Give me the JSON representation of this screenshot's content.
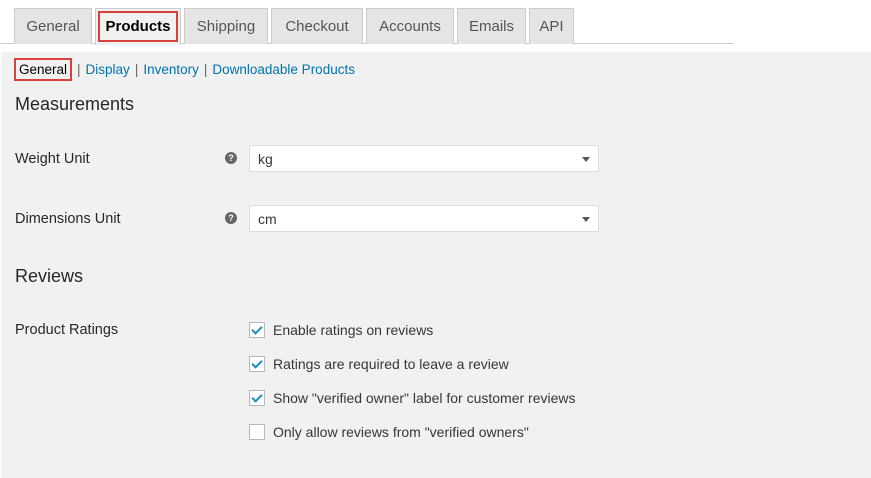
{
  "tabs": [
    {
      "label": "General"
    },
    {
      "label": "Products"
    },
    {
      "label": "Shipping"
    },
    {
      "label": "Checkout"
    },
    {
      "label": "Accounts"
    },
    {
      "label": "Emails"
    },
    {
      "label": "API"
    }
  ],
  "active_tab": "Products",
  "subnav": {
    "current": "General",
    "links": [
      "Display",
      "Inventory",
      "Downloadable Products"
    ],
    "separator": "|"
  },
  "measurements": {
    "title": "Measurements",
    "weight_label": "Weight Unit",
    "weight_value": "kg",
    "dimensions_label": "Dimensions Unit",
    "dimensions_value": "cm",
    "help_glyph": "?"
  },
  "reviews": {
    "title": "Reviews",
    "ratings_label": "Product Ratings",
    "options": [
      {
        "label": "Enable ratings on reviews",
        "checked": true
      },
      {
        "label": "Ratings are required to leave a review",
        "checked": true
      },
      {
        "label": "Show \"verified owner\" label for customer reviews",
        "checked": true
      },
      {
        "label": "Only allow reviews from \"verified owners\"",
        "checked": false
      }
    ]
  },
  "colors": {
    "highlight_red": "#d9423a",
    "link_blue": "#0073aa",
    "check_blue": "#1e8cbe"
  },
  "icons": {
    "help": "help-icon",
    "dropdown": "chevron-down-icon",
    "check": "checkmark-icon"
  }
}
